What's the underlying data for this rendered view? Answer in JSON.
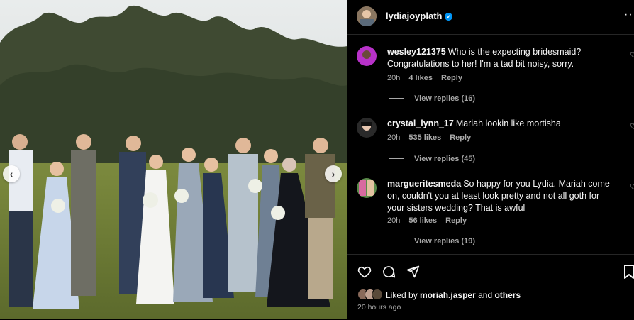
{
  "post": {
    "username": "lydiajoyplath",
    "more_label": "···"
  },
  "comments": [
    {
      "user": "wesley121375",
      "text": "Who is the expecting bridesmaid? Congratulations to her! I'm a tad bit noisy, sorry.",
      "time": "20h",
      "likes": "4 likes",
      "reply": "Reply",
      "view_replies": "View replies (16)",
      "avatar_color": "#b832c9"
    },
    {
      "user": "crystal_lynn_17",
      "text": "Mariah lookin like mortisha",
      "time": "20h",
      "likes": "535 likes",
      "reply": "Reply",
      "view_replies": "View replies (45)",
      "avatar_color": "#3a3a3a"
    },
    {
      "user": "margueritesmeda",
      "text": "So happy for you Lydia. Mariah come on, couldn't you at least look pretty and not all goth for your sisters wedding? That is awful",
      "time": "20h",
      "likes": "56 likes",
      "reply": "Reply",
      "view_replies": "View replies (19)",
      "avatar_color": "#5a8a4a"
    }
  ],
  "footer": {
    "liked_prefix": "Liked by",
    "liked_user": "moriah.jasper",
    "liked_and": "and",
    "liked_others": "others",
    "timestamp": "20 hours ago"
  },
  "colors": {
    "background": "#000000",
    "verified": "#0095f6",
    "muted_text": "#a8a8a8",
    "divider": "#262626"
  },
  "icons": [
    "chevron-left-icon",
    "chevron-right-icon",
    "verified-icon",
    "more-icon",
    "heart-icon",
    "comment-icon",
    "share-icon",
    "bookmark-icon"
  ]
}
